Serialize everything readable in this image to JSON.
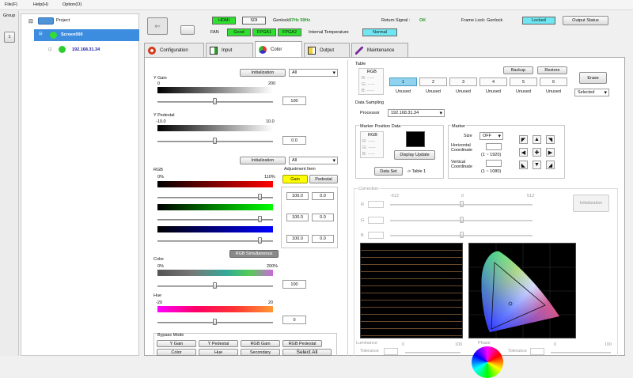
{
  "menu": [
    "File(F)",
    "Help(H)",
    "Option(O)"
  ],
  "sidebar": {
    "group_label": "Group",
    "group_button": "1"
  },
  "tree": {
    "root": "Project",
    "screen": "Screen000",
    "ip": "192.168.31.34"
  },
  "status": {
    "hdmi": "HDMI",
    "sdi": "SDI",
    "genlock_label": "Genlock :",
    "genlock_value": "57Hz 59Hz",
    "return_signal_label": "Return Signal :",
    "return_signal_value": "OK",
    "frame_lock_label": "Frame Lock: Genlock",
    "frame_lock_value": "Locked",
    "output_status_button": "Output Status",
    "fan_label": "FAN",
    "fan_value": "Good",
    "fpga1": "FPGA1",
    "fpga2": "FPGA2",
    "internal_temp_label": "Internal Temperature",
    "internal_temp_value": "Normal"
  },
  "tabs": [
    "Configuration",
    "Input",
    "Color",
    "Output",
    "Maintenance"
  ],
  "color": {
    "init_button": "Initialization",
    "select_all": "All",
    "ygain": {
      "label": "Y Gain",
      "min": "0",
      "max": "200",
      "value": "100"
    },
    "ypedestal": {
      "label": "Y Pedestal",
      "min": "-10.0",
      "max": "10.0",
      "value": "0.0"
    },
    "rgb_label": "RGB",
    "rgb_min": "0%",
    "rgb_max": "110%",
    "adjust_item_label": "Adjustment Item",
    "gain_button": "Gain",
    "pedestal_button": "Pedestal",
    "rgb_rows": [
      {
        "gain": "100.0",
        "pedestal": "0.0"
      },
      {
        "gain": "100.0",
        "pedestal": "0.0"
      },
      {
        "gain": "100.0",
        "pedestal": "0.0"
      }
    ],
    "rgb_simultaneous": "RGB Simultaneous",
    "color_sat": {
      "label": "Color",
      "min": "0%",
      "max": "200%",
      "value": "100"
    },
    "hue": {
      "label": "Hue",
      "min": "-20",
      "max": "20",
      "value": "0"
    },
    "bypass_label": "Bypass Mode",
    "bypass_row1": [
      "Y Gain",
      "Y Pedestal",
      "RGB Gain",
      "RGB Pedestal"
    ],
    "bypass_row2": [
      "Color",
      "Hue",
      "Secondary",
      "Select All"
    ]
  },
  "table": {
    "label": "Table",
    "rgb_label": "RGB",
    "backup": "Backup",
    "restore": "Restore",
    "erase": "Erase",
    "cells": [
      "1",
      "2",
      "3",
      "4",
      "5",
      "6"
    ],
    "unused": [
      "Unused",
      "Unused",
      "Unused",
      "Unused",
      "Unused",
      "Unused"
    ],
    "selected": "Selected"
  },
  "sampling": {
    "label": "Data Sampling",
    "processor_label": "Processor",
    "processor_value": "192.168.31.34",
    "marker_pos_label": "Marker Position Data",
    "rgb_label": "RGB",
    "display_update": "Display Update",
    "data_set": "Data Set",
    "to_table": "-> Table 1",
    "marker_label": "Marker",
    "size_label": "Size",
    "size_value": "OFF",
    "horizontal_label": "Horizontal\nCoordinate",
    "horizontal_range": "(1 ~ 1920)",
    "vertical_label": "Vertical\nCoordinate",
    "vertical_range": "(1 ~ 1080)"
  },
  "correction": {
    "label": "Correction",
    "min": "-512",
    "mid": "0",
    "max": "512",
    "channels": [
      "R",
      "G",
      "B"
    ],
    "init_button": "Initialization",
    "luminance_label": "Luminance",
    "phase_label": "Phase",
    "tolerance_label": "Tolerance"
  }
}
